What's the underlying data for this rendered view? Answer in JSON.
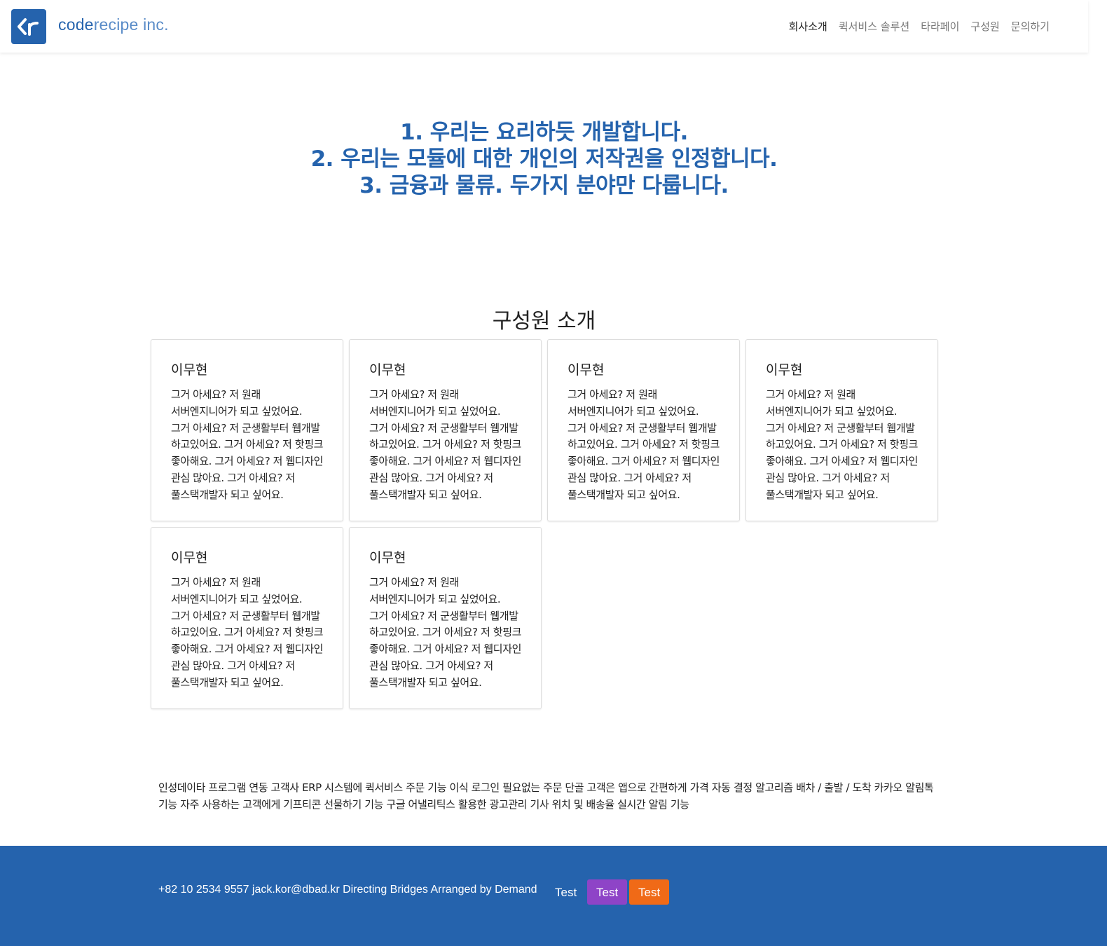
{
  "header": {
    "logo_glyph": "<r",
    "logo_code": "code",
    "logo_rest": "recipe inc.",
    "nav": [
      "회사소개",
      "퀵서비스 솔루션",
      "타라페이",
      "구성원",
      "문의하기"
    ],
    "active_nav": "회사소개",
    "brand_color": "#2563ad"
  },
  "hero": {
    "lines": [
      "1. 우리는 요리하듯 개발합니다.",
      "2. 우리는 모듈에 대한 개인의 저작권을 인정합니다.",
      "3. 금융과 물류. 두가지 분야만 다룹니다."
    ]
  },
  "team": {
    "title": "구성원 소개",
    "members": [
      {
        "name": "이무현",
        "desc": "그거 아세요? 저 원래 서버엔지니어가 되고 싶었어요. 그거 아세요? 저 군생활부터 웹개발 하고있어요. 그거 아세요? 저 핫핑크 좋아해요. 그거 아세요? 저 웹디자인 관심 많아요. 그거 아세요? 저 풀스택개발자 되고 싶어요."
      },
      {
        "name": "이무현",
        "desc": "그거 아세요? 저 원래 서버엔지니어가 되고 싶었어요. 그거 아세요? 저 군생활부터 웹개발 하고있어요. 그거 아세요? 저 핫핑크 좋아해요. 그거 아세요? 저 웹디자인 관심 많아요. 그거 아세요? 저 풀스택개발자 되고 싶어요."
      },
      {
        "name": "이무현",
        "desc": "그거 아세요? 저 원래 서버엔지니어가 되고 싶었어요. 그거 아세요? 저 군생활부터 웹개발 하고있어요. 그거 아세요? 저 핫핑크 좋아해요. 그거 아세요? 저 웹디자인 관심 많아요. 그거 아세요? 저 풀스택개발자 되고 싶어요."
      },
      {
        "name": "이무현",
        "desc": "그거 아세요? 저 원래 서버엔지니어가 되고 싶었어요. 그거 아세요? 저 군생활부터 웹개발 하고있어요. 그거 아세요? 저 핫핑크 좋아해요. 그거 아세요? 저 웹디자인 관심 많아요. 그거 아세요? 저 풀스택개발자 되고 싶어요."
      },
      {
        "name": "이무현",
        "desc": "그거 아세요? 저 원래 서버엔지니어가 되고 싶었어요. 그거 아세요? 저 군생활부터 웹개발 하고있어요. 그거 아세요? 저 핫핑크 좋아해요. 그거 아세요? 저 웹디자인 관심 많아요. 그거 아세요? 저 풀스택개발자 되고 싶어요."
      },
      {
        "name": "이무현",
        "desc": "그거 아세요? 저 원래 서버엔지니어가 되고 싶었어요. 그거 아세요? 저 군생활부터 웹개발 하고있어요. 그거 아세요? 저 핫핑크 좋아해요. 그거 아세요? 저 웹디자인 관심 많아요. 그거 아세요? 저 풀스택개발자 되고 싶어요."
      }
    ]
  },
  "services": {
    "text": "인성데이타 프로그램 연동 고객사 ERP 시스템에 퀵서비스 주문 기능 이식 로그인 필요없는 주문 단골 고객은 앱으로 간편하게 가격 자동 결정 알고리즘 배차 / 출발 / 도착 카카오 알림톡 기능 자주 사용하는 고객에게 기프티콘 선물하기 기능 구글 어낼리틱스 활용한 광고관리 기사 위치 및 배송율 실시간 알림 기능"
  },
  "footer": {
    "info": "+82 10 2534 9557 jack.kor@dbad.kr Directing Bridges Arranged by Demand",
    "buttons": [
      "Test",
      "Test",
      "Test"
    ],
    "button_colors": [
      "transparent",
      "#8e44c7",
      "#f06a17"
    ]
  }
}
